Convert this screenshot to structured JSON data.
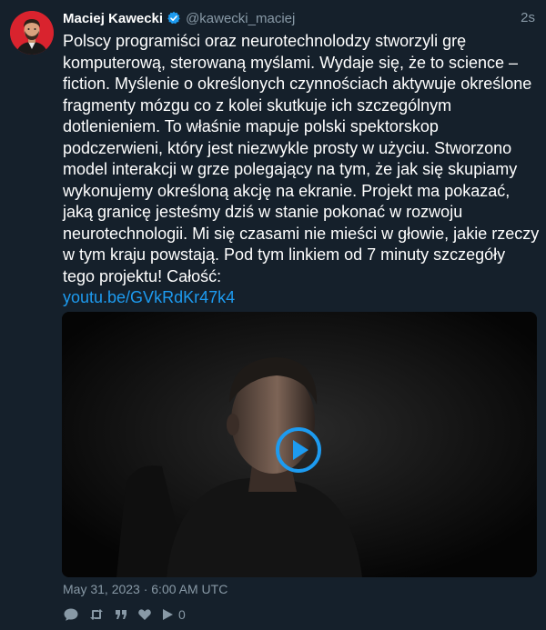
{
  "author": {
    "name": "Maciej Kawecki",
    "handle": "@kawecki_maciej",
    "verified": true
  },
  "relative_time": "2s",
  "tweet": {
    "text": "Polscy programiści oraz neurotechnolodzy stworzyli grę komputerową, sterowaną myślami. Wydaje się, że to science – fiction. Myślenie o określonych czynnościach aktywuje określone fragmenty mózgu co z kolei skutkuje ich szczególnym dotlenieniem. To właśnie mapuje polski spektorskop podczerwieni, który jest niezwykle prosty w użyciu. Stworzono model interakcji w grze polegający na tym, że jak się skupiamy wykonujemy określoną akcję na ekranie. Projekt ma pokazać, jaką granicę jesteśmy dziś w stanie pokonać w rozwoju neurotechnologii. Mi się czasami nie mieści w głowie, jakie rzeczy w tym kraju powstają. Pod tym linkiem od 7 minuty szczegóły tego projektu! Całość:",
    "link_text": "youtu.be/GVkRdKr47k4"
  },
  "media": {
    "type": "video",
    "play_icon": "play-circle-icon"
  },
  "timestamp": "May 31, 2023 · 6:00 AM UTC",
  "actions": {
    "icons": [
      "reply-icon",
      "retweet-icon",
      "quote-icon",
      "like-icon",
      "views-icon"
    ],
    "views_count": "0"
  },
  "colors": {
    "background": "#15202b",
    "link": "#1d9bf0",
    "muted": "#8899a6",
    "verified_badge": "#1d9bf0",
    "avatar_bg": "#d9232e"
  }
}
